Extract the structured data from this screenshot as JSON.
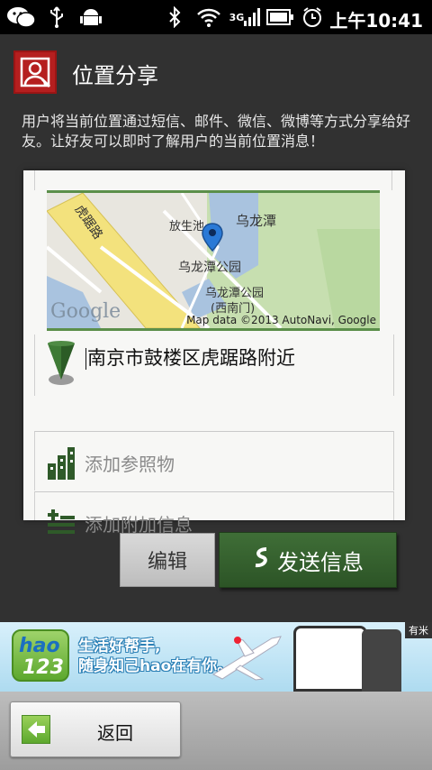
{
  "status_bar": {
    "time": "上午10:41",
    "network": "3G",
    "icons": [
      "wechat-icon",
      "usb-icon",
      "android-icon",
      "bluetooth-icon",
      "wifi-icon",
      "signal-icon",
      "battery-icon",
      "alarm-icon"
    ]
  },
  "header": {
    "title": "位置分享",
    "app_icon": "person-location-icon"
  },
  "description": "用户将当前位置通过短信、邮件、微信、微博等方式分享给好友。让好友可以即时了解用户的当前位置消息！",
  "map": {
    "labels": [
      "虎踞路",
      "放生池",
      "乌龙潭",
      "乌龙潭公园",
      "乌龙潭公园",
      "(西南门)"
    ],
    "logo": "Google",
    "credit": "Map data ©2013 AutoNavi, Google"
  },
  "location": {
    "address": "南京市鼓楼区虎踞路附近"
  },
  "rows": {
    "add_reference": "添加参照物",
    "add_info": "添加附加信息"
  },
  "buttons": {
    "edit": "编辑",
    "send": "发送信息",
    "back": "返回"
  },
  "ad": {
    "logo_top": "hao",
    "logo_bottom": "123",
    "line1": "生活好帮手,",
    "line2": "随身知己hao在有你。",
    "tag": "有米"
  },
  "colors": {
    "accent_green": "#2f5a29",
    "app_icon_red": "#b51f1f",
    "background": "#313131"
  }
}
